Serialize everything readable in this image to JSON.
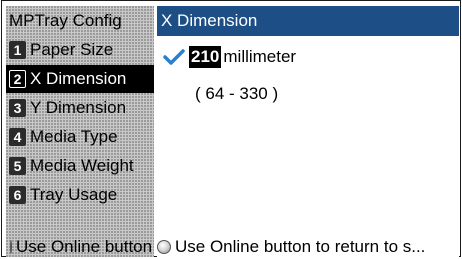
{
  "left_panel": {
    "title": "MPTray Config",
    "items": [
      {
        "number": "1",
        "label": "Paper Size"
      },
      {
        "number": "2",
        "label": "X Dimension"
      },
      {
        "number": "3",
        "label": "Y Dimension"
      },
      {
        "number": "4",
        "label": "Media Type"
      },
      {
        "number": "5",
        "label": "Media Weight"
      },
      {
        "number": "6",
        "label": "Tray Usage"
      }
    ],
    "selected_index": 1,
    "footer": "Use Online button to return to s..."
  },
  "right_panel": {
    "title": "X Dimension",
    "value": "210",
    "unit": "millimeter",
    "range": "( 64 - 330 )",
    "footer": "Use Online button to return to s..."
  },
  "colors": {
    "title_bar": "#1d4f86",
    "check": "#2a7fd4",
    "selected_bg": "#000000"
  },
  "icons": {
    "check": "check-icon",
    "online_button": "online-button-icon"
  }
}
